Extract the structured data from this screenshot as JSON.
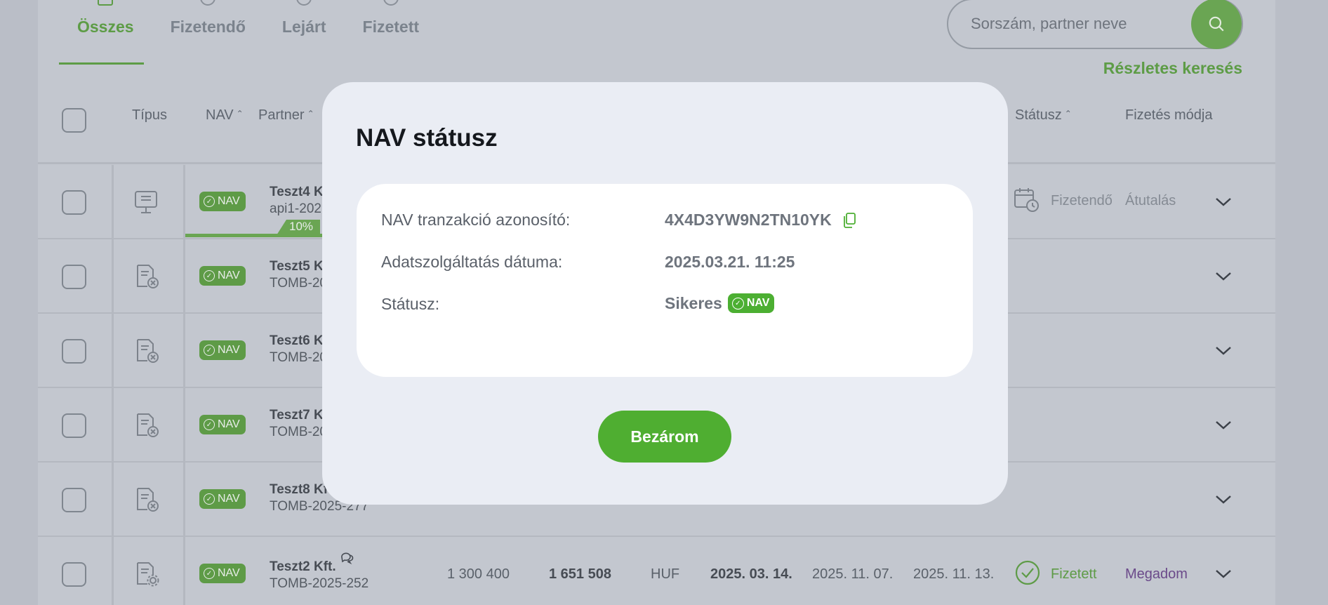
{
  "tabs": [
    {
      "label": "Összes",
      "active": true
    },
    {
      "label": "Fizetendő",
      "active": false
    },
    {
      "label": "Lejárt",
      "active": false
    },
    {
      "label": "Fizetett",
      "active": false
    }
  ],
  "search": {
    "placeholder": "Sorszám, partner neve",
    "advanced_label": "Részletes keresés"
  },
  "table": {
    "headers": {
      "type": "Típus",
      "nav": "NAV",
      "partner": "Partner",
      "status": "Státusz",
      "payment": "Fizetés módja"
    },
    "nav_badge_label": "NAV",
    "rows": [
      {
        "partner": "Teszt4 K",
        "id": "api1-202",
        "progress_label": "10%",
        "status": "Fizetendő",
        "payment": "Átutalás",
        "icon": "monitor-document-icon"
      },
      {
        "partner": "Teszt5 K",
        "id": "TOMB-20",
        "icon": "document-cancel-icon"
      },
      {
        "partner": "Teszt6 K",
        "id": "TOMB-20",
        "icon": "document-cancel-icon"
      },
      {
        "partner": "Teszt7 K",
        "id": "TOMB-20",
        "icon": "document-cancel-icon"
      },
      {
        "partner": "Teszt8 Kft.",
        "id": "TOMB-2025-277",
        "icon": "document-cancel-icon"
      },
      {
        "partner": "Teszt2 Kft.",
        "id": "TOMB-2025-252",
        "net": "1 300 400",
        "gross": "1 651 508",
        "currency": "HUF",
        "issue_date": "2025. 03. 14.",
        "due_date": "2025. 11. 07.",
        "perf_date": "2025. 11. 13.",
        "status": "Fizetett",
        "payment": "Megadom",
        "icon": "document-gear-icon"
      }
    ]
  },
  "modal": {
    "title": "NAV státusz",
    "transaction_label": "NAV tranzakció azonosító:",
    "transaction_value": "4X4D3YW9N2TN10YK",
    "date_label": "Adatszolgáltatás dátuma:",
    "date_value": "2025.03.21. 11:25",
    "status_label": "Státusz:",
    "status_value": "Sikeres",
    "status_badge": "NAV",
    "close_label": "Bezárom"
  },
  "colors": {
    "accent_green": "#4fae31",
    "modal_bg": "#eaedf4",
    "overlay": "#babec7",
    "purple_link": "#6b4a8a"
  }
}
